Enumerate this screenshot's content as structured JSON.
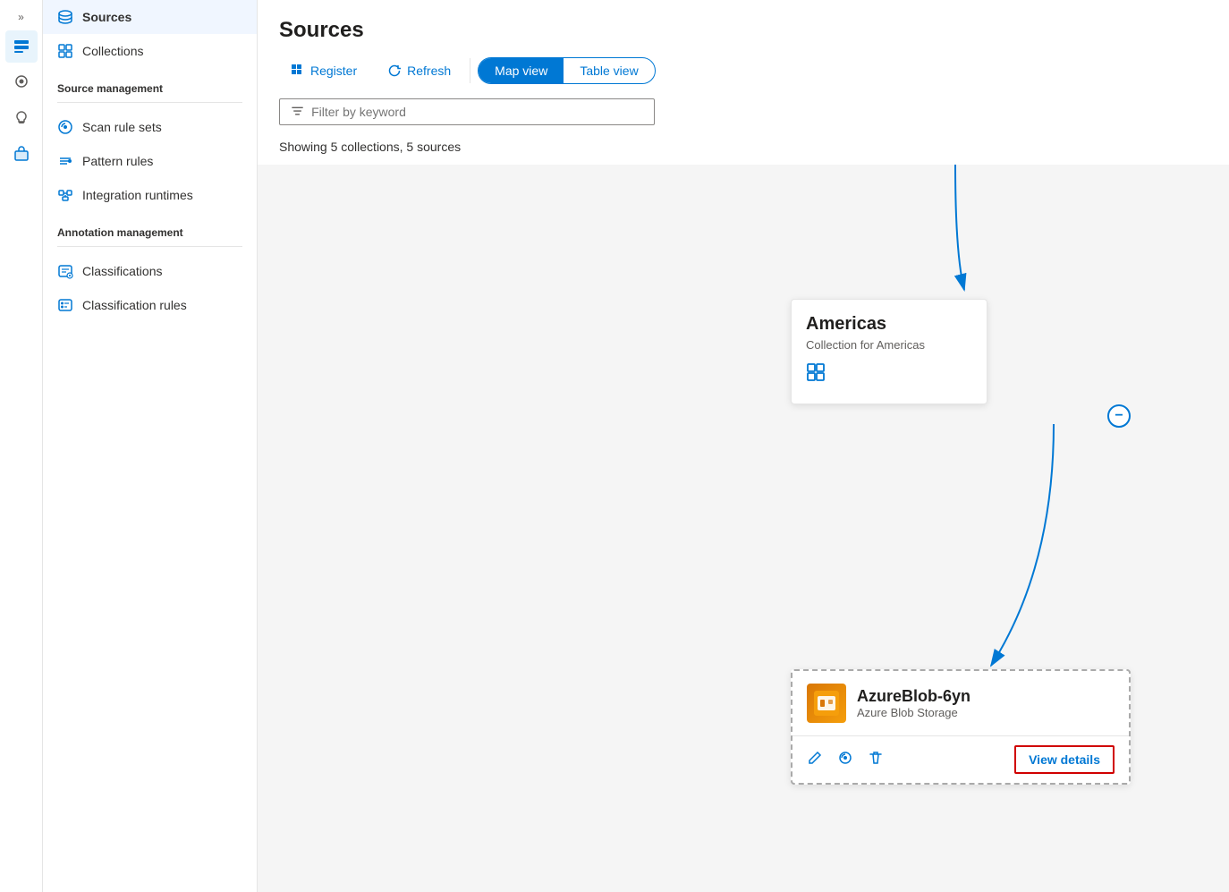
{
  "iconRail": {
    "chevron": "»",
    "icons": [
      {
        "name": "catalog-icon",
        "symbol": "🗄",
        "active": true
      },
      {
        "name": "map-icon",
        "symbol": "📍",
        "active": false
      },
      {
        "name": "lightbulb-icon",
        "symbol": "💡",
        "active": false
      },
      {
        "name": "briefcase-icon",
        "symbol": "💼",
        "active": false
      }
    ]
  },
  "sidebar": {
    "navItems": [
      {
        "id": "sources",
        "label": "Sources",
        "active": true
      },
      {
        "id": "collections",
        "label": "Collections",
        "active": false
      }
    ],
    "sourceManagement": {
      "label": "Source management",
      "items": [
        {
          "id": "scan-rule-sets",
          "label": "Scan rule sets"
        },
        {
          "id": "pattern-rules",
          "label": "Pattern rules"
        },
        {
          "id": "integration-runtimes",
          "label": "Integration runtimes"
        }
      ]
    },
    "annotationManagement": {
      "label": "Annotation management",
      "items": [
        {
          "id": "classifications",
          "label": "Classifications"
        },
        {
          "id": "classification-rules",
          "label": "Classification rules"
        }
      ]
    }
  },
  "main": {
    "title": "Sources",
    "toolbar": {
      "registerLabel": "Register",
      "refreshLabel": "Refresh",
      "mapViewLabel": "Map view",
      "tableViewLabel": "Table view"
    },
    "filter": {
      "placeholder": "Filter by keyword"
    },
    "showingText": "Showing 5 collections, 5 sources"
  },
  "mapView": {
    "collectionCard": {
      "title": "Americas",
      "subtitle": "Collection for Americas"
    },
    "sourceCard": {
      "name": "AzureBlob-6yn",
      "type": "Azure Blob Storage",
      "viewDetailsLabel": "View details"
    }
  }
}
